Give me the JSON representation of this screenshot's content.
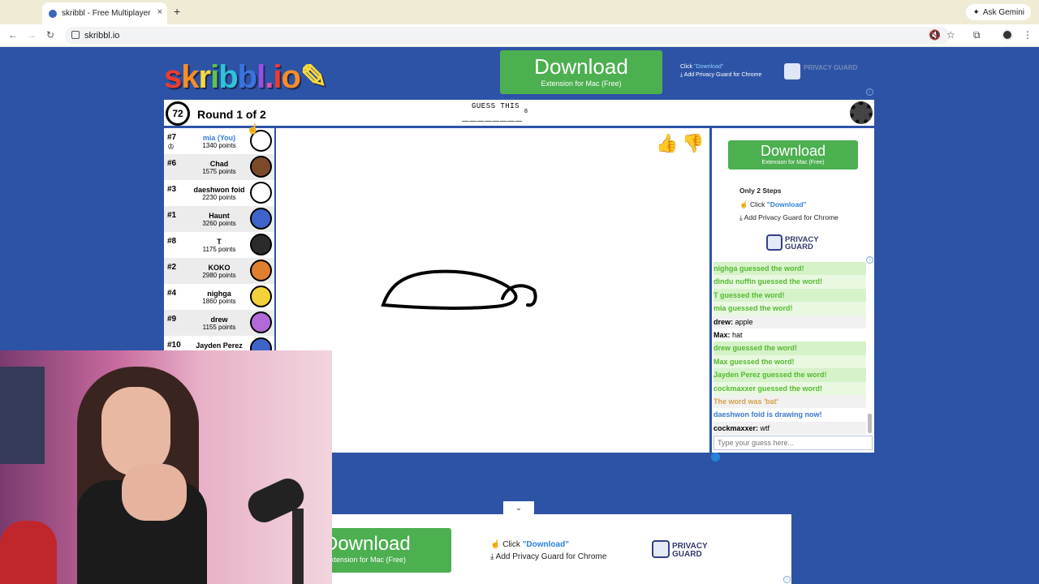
{
  "browser": {
    "tab_title": "skribbl - Free Multiplayer Dra",
    "new_tab": "+",
    "close_tab": "×",
    "ask_gemini": "Ask Gemini",
    "url": "skribbl.io"
  },
  "logo": "skribbl.io",
  "top_ad": {
    "download": "Download",
    "subtitle": "Extension for Mac (Free)",
    "step1_prefix": "Click",
    "step1_link": "\"Download\"",
    "step2": "Add Privacy Guard for Chrome",
    "brand": "PRIVACY GUARD"
  },
  "game": {
    "timer": "72",
    "round": "Round 1 of 2",
    "guess_label": "GUESS THIS",
    "word_mask": "________",
    "word_length": "8"
  },
  "players": [
    {
      "rank": "#7",
      "name": "mia (You)",
      "points": "1340 points",
      "you": true,
      "color": "#ffffff"
    },
    {
      "rank": "#6",
      "name": "Chad",
      "points": "1575 points",
      "color": "#7b4a2b"
    },
    {
      "rank": "#3",
      "name": "daeshwon foid",
      "points": "2230 points",
      "color": "#ffffff"
    },
    {
      "rank": "#1",
      "name": "Haunt",
      "points": "3260 points",
      "color": "#3e64c9"
    },
    {
      "rank": "#8",
      "name": "T",
      "points": "1175 points",
      "color": "#2b2b2b"
    },
    {
      "rank": "#2",
      "name": "KOKO",
      "points": "2980 points",
      "color": "#e0802f"
    },
    {
      "rank": "#4",
      "name": "nighga",
      "points": "1860 points",
      "color": "#f2d23a"
    },
    {
      "rank": "#9",
      "name": "drew",
      "points": "1155 points",
      "color": "#b26ad9"
    },
    {
      "rank": "#10",
      "name": "Jayden Perez",
      "points": "",
      "color": "#3e64c9"
    }
  ],
  "side_ad": {
    "download": "Download",
    "subtitle": "Extension for Mac (Free)",
    "steps_title": "Only 2 Steps",
    "step1_prefix": "Click",
    "step1_link": "\"Download\"",
    "step2": "Add Privacy Guard for Chrome",
    "brand_line1": "PRIVACY",
    "brand_line2": "GUARD"
  },
  "chat": [
    {
      "type": "ok",
      "text": "nighga guessed the word!"
    },
    {
      "type": "okb",
      "text": "dindu nuffin guessed the word!"
    },
    {
      "type": "ok",
      "text": "T guessed the word!"
    },
    {
      "type": "okb",
      "text": "mia guessed the word!"
    },
    {
      "type": "msg",
      "user": "drew:",
      "text": " apple"
    },
    {
      "type": "msg",
      "user": "Max:",
      "text": " hat"
    },
    {
      "type": "ok",
      "text": "drew guessed the word!"
    },
    {
      "type": "okb",
      "text": "Max guessed the word!"
    },
    {
      "type": "ok",
      "text": "Jayden Perez guessed the word!"
    },
    {
      "type": "okb",
      "text": "cockmaxxer guessed the word!"
    },
    {
      "type": "sys1",
      "text": "The word was 'bat'"
    },
    {
      "type": "sys2",
      "text": "daeshwon foid is drawing now!"
    },
    {
      "type": "msg",
      "user": "cockmaxxer:",
      "text": " wtf"
    }
  ],
  "guess_input_placeholder": "Type your guess here...",
  "bottom_ad": {
    "download": "Download",
    "subtitle": "Extension for Mac (Free)",
    "step1_prefix": "Click",
    "step1_link": "\"Download\"",
    "step2": "Add Privacy Guard for Chrome",
    "brand_line1": "PRIVACY",
    "brand_line2": "GUARD"
  },
  "colors": {
    "background": "#2c53a6",
    "download_green": "#4caf50",
    "guessed_green": "#55b931",
    "link_blue": "#2a82d6"
  }
}
